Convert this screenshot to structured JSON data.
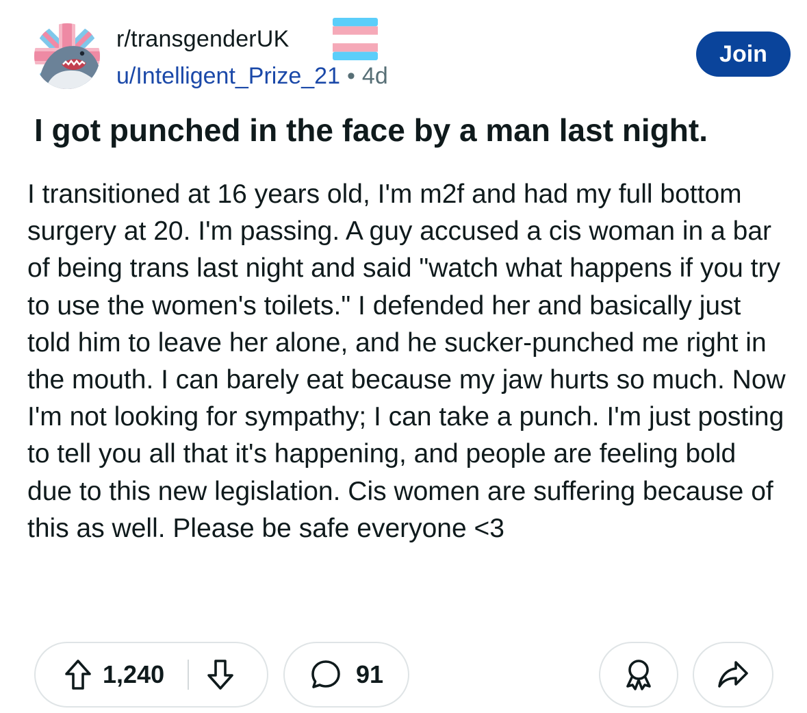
{
  "subreddit": {
    "name": "r/transgenderUK",
    "flag_icon": "transgender-flag-emoji",
    "avatar_icon": "union-jack-shark-avatar"
  },
  "post_meta": {
    "username": "u/Intelligent_Prize_21",
    "separator": "•",
    "age": "4d"
  },
  "actions": {
    "join_label": "Join"
  },
  "post": {
    "title": "I got punched in the face by a man last night.",
    "body": "I transitioned at 16 years old, I'm m2f and had my full bottom surgery at 20. I'm passing. A guy accused a cis woman in a bar of being trans last night and said \"watch what happens if you try to use the women's toilets.\" I defended her and basically just told him to leave her alone, and he sucker-punched me right in the mouth. I can barely eat because my jaw hurts so much. Now I'm not looking for sympathy; I can take a punch. I'm just posting to tell you all that it's happening, and people are feeling bold due to this new legislation. Cis women are suffering because of this as well. Please be safe everyone <3"
  },
  "footer": {
    "upvote_icon": "upvote-arrow-icon",
    "vote_count": "1,240",
    "downvote_icon": "downvote-arrow-icon",
    "comment_icon": "comment-bubble-icon",
    "comment_count": "91",
    "award_icon": "award-icon",
    "share_icon": "share-arrow-icon"
  },
  "colors": {
    "join_button": "#0a449b",
    "username_link": "#1a48a8",
    "meta_gray": "#576f76",
    "trans_blue": "#5bcefa",
    "trans_pink": "#f5a9b8"
  }
}
